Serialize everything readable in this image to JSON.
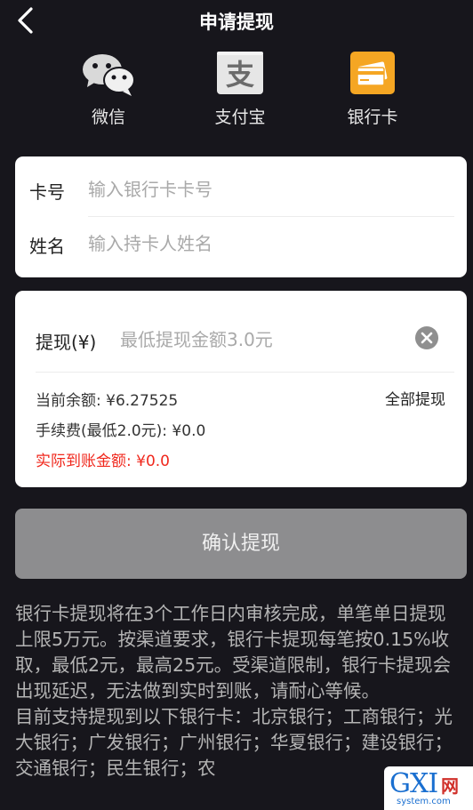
{
  "header": {
    "title": "申请提现"
  },
  "methods": [
    {
      "label": "微信",
      "icon": "wechat-icon"
    },
    {
      "label": "支付宝",
      "icon": "alipay-icon"
    },
    {
      "label": "银行卡",
      "icon": "bank-card-icon"
    }
  ],
  "bank_form": {
    "card_label": "卡号",
    "card_placeholder": "输入银行卡卡号",
    "name_label": "姓名",
    "name_placeholder": "输入持卡人姓名"
  },
  "withdraw": {
    "amount_label": "提现(¥)",
    "amount_placeholder": "最低提现金额3.0元",
    "balance": "当前余额: ¥6.27525",
    "fee": "手续费(最低2.0元): ¥0.0",
    "actual": "实际到账金额: ¥0.0",
    "withdraw_all": "全部提现"
  },
  "confirm_label": "确认提现",
  "notice": "银行卡提现将在3个工作日内审核完成，单笔单日提现上限5万元。按渠道要求，银行卡提现每笔按0.15%收取，最低2元，最高25元。受渠道限制，银行卡提现会出现延迟，无法做到实时到账，请耐心等候。\n目前支持提现到以下银行卡：北京银行；工商银行；光大银行；广发银行；广州银行；华夏银行；建设银行；交通银行；民生银行；农",
  "watermark": {
    "brand": "GXI",
    "cn": "网",
    "url": "system.com"
  },
  "colors": {
    "background": "#17161c",
    "accent_red": "#f0281d",
    "button_gray": "#8d8d8f",
    "bank_icon": "#f5a623"
  }
}
